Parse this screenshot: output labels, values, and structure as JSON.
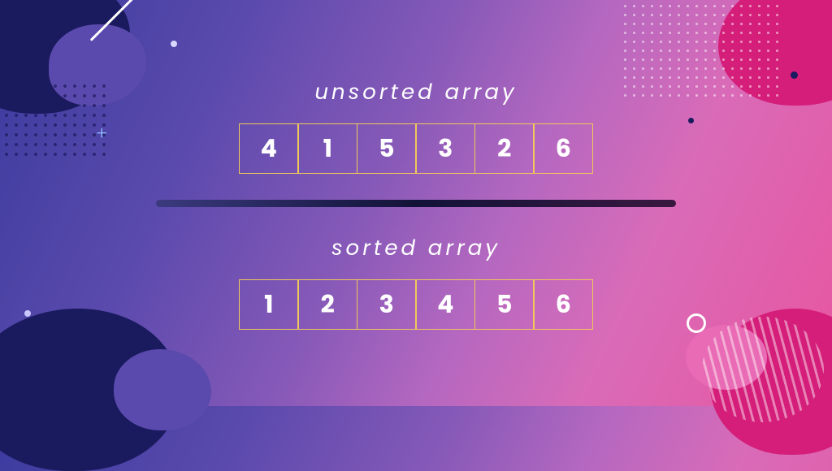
{
  "unsorted": {
    "label": "unsorted array",
    "values": [
      "4",
      "1",
      "5",
      "3",
      "2",
      "6"
    ]
  },
  "sorted": {
    "label": "sorted array",
    "values": [
      "1",
      "2",
      "3",
      "4",
      "5",
      "6"
    ]
  }
}
